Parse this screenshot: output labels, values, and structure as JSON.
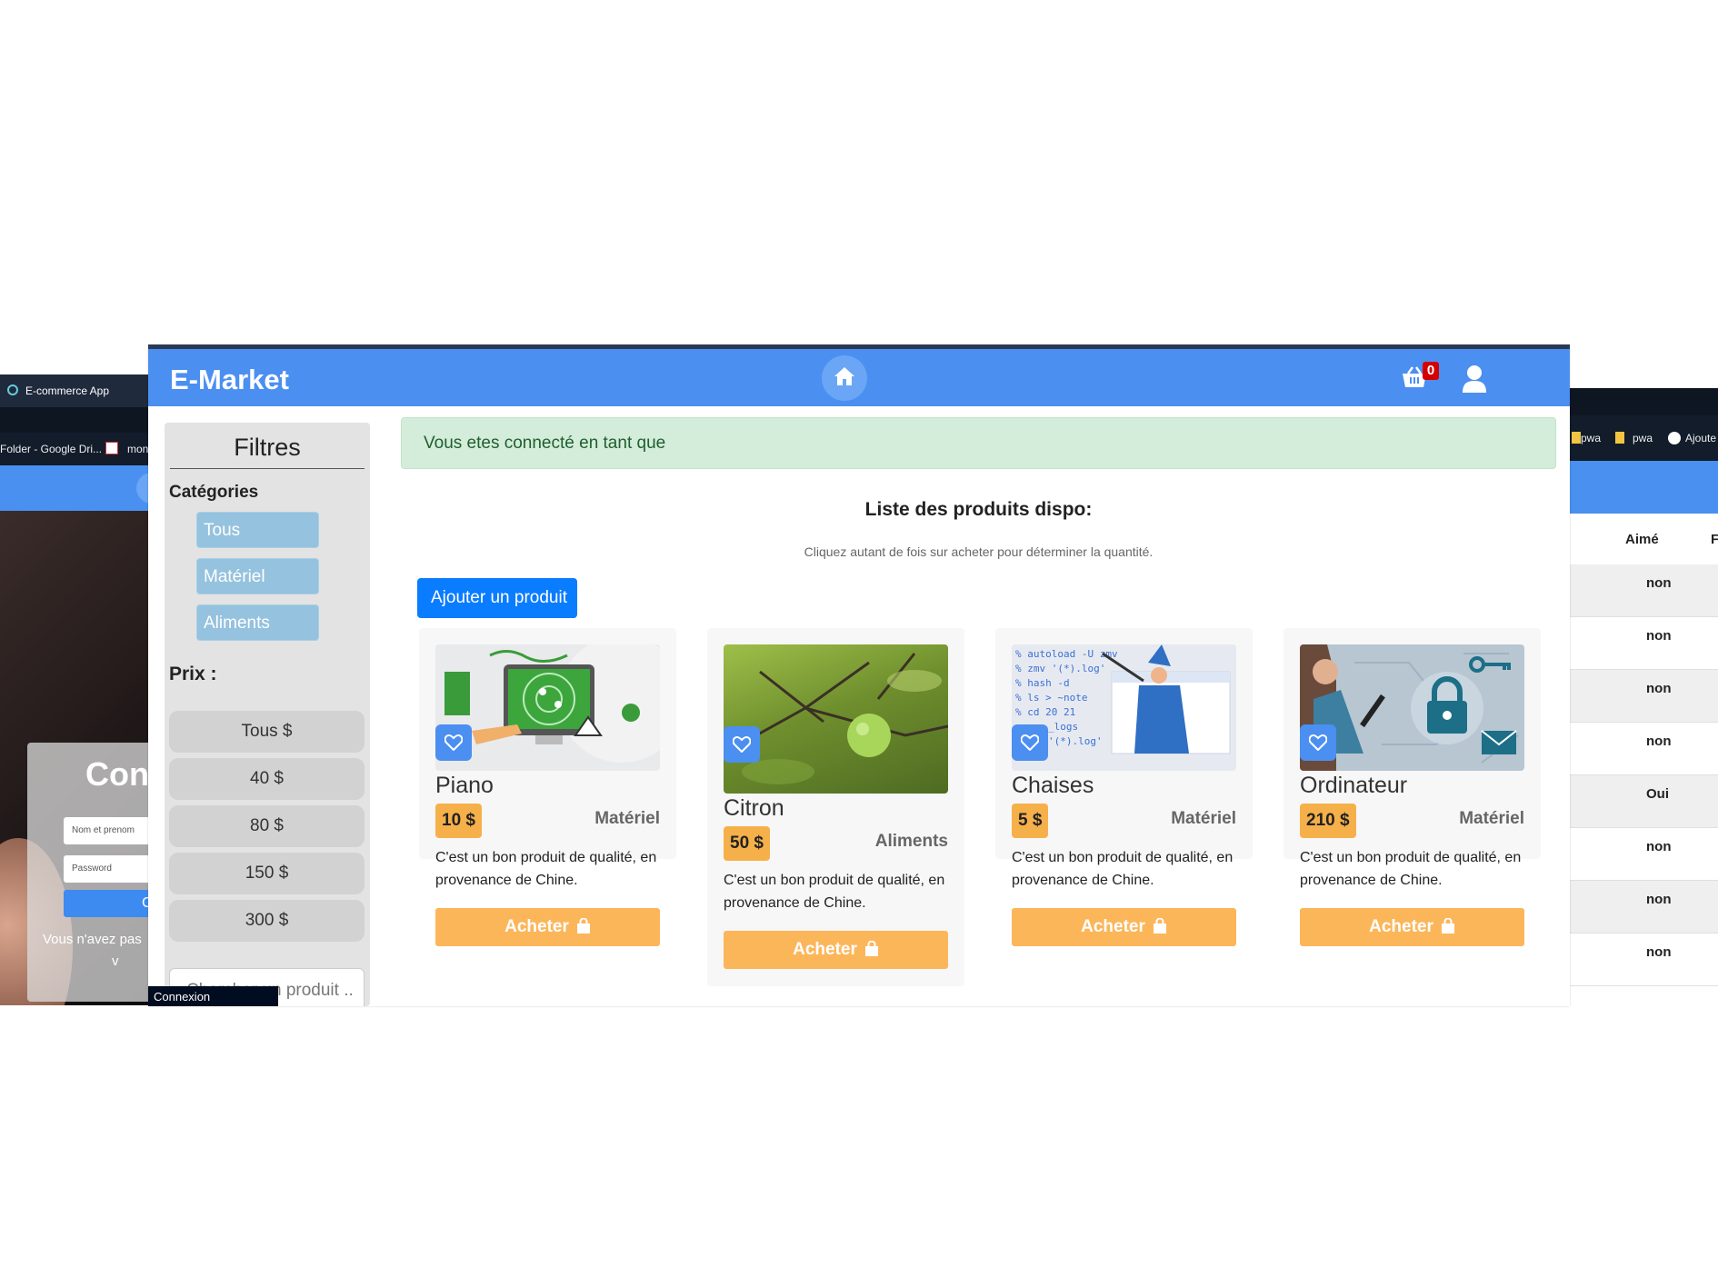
{
  "left_window": {
    "tab_title": "E-commerce App",
    "bookmark_1": "Folder - Google Dri...",
    "bookmark_2": "mon",
    "login_title": "Con",
    "name_placeholder": "Nom et prenom",
    "password_placeholder": "Password",
    "login_button": "C",
    "footer_text": "Vous n'avez pas",
    "footer_text_2": "v"
  },
  "right_window": {
    "bookmarks": [
      "pwa",
      "pwa",
      "Ajoute"
    ],
    "columns": [
      "Aimé",
      "F"
    ],
    "rows": [
      "non",
      "non",
      "non",
      "non",
      "Oui",
      "non",
      "non",
      "non"
    ]
  },
  "navbar": {
    "brand": "E-Market",
    "cart_count": "0"
  },
  "sidebar": {
    "title": "Filtres",
    "categories_label": "Catégories",
    "categories": [
      "Tous",
      "Matériel",
      "Aliments"
    ],
    "price_label": "Prix :",
    "prices": [
      "Tous $",
      "40 $",
      "80 $",
      "150 $",
      "300 $"
    ],
    "search_placeholder": "Chercher un produit ..",
    "search_visible_text": "produit .."
  },
  "tooltip": "Connexion",
  "content": {
    "alert": "Vous etes connecté en tant que",
    "list_title": "Liste des produits dispo:",
    "list_subtitle": "Cliquez autant de fois sur acheter pour déterminer la quantité.",
    "add_button": "Ajouter un produit",
    "products": [
      {
        "name": "Piano",
        "price": "10 $",
        "category": "Matériel",
        "description": "C'est un bon produit de qualité, en provenance de Chine.",
        "buy_label": "Acheter"
      },
      {
        "name": "Citron",
        "price": "50 $",
        "category": "Aliments",
        "description": "C'est un bon produit de qualité, en provenance de Chine.",
        "buy_label": "Acheter"
      },
      {
        "name": "Chaises",
        "price": "5 $",
        "category": "Matériel",
        "description": "C'est un bon produit de qualité, en provenance de Chine.",
        "buy_label": "Acheter"
      },
      {
        "name": "Ordinateur",
        "price": "210 $",
        "category": "Matériel",
        "description": "C'est un bon produit de qualité, en provenance de Chine.",
        "buy_label": "Acheter"
      }
    ]
  },
  "colors": {
    "navbar": "#4b8ff1",
    "category_button": "#95c2de",
    "price_badge": "#f6b04a",
    "buy_button": "#fcb65a",
    "alert_bg": "#d4ecda",
    "primary_button": "#0a7cff"
  },
  "icons": [
    "home-icon",
    "cart-icon",
    "user-icon",
    "heart-icon",
    "shopping-bag-icon"
  ]
}
